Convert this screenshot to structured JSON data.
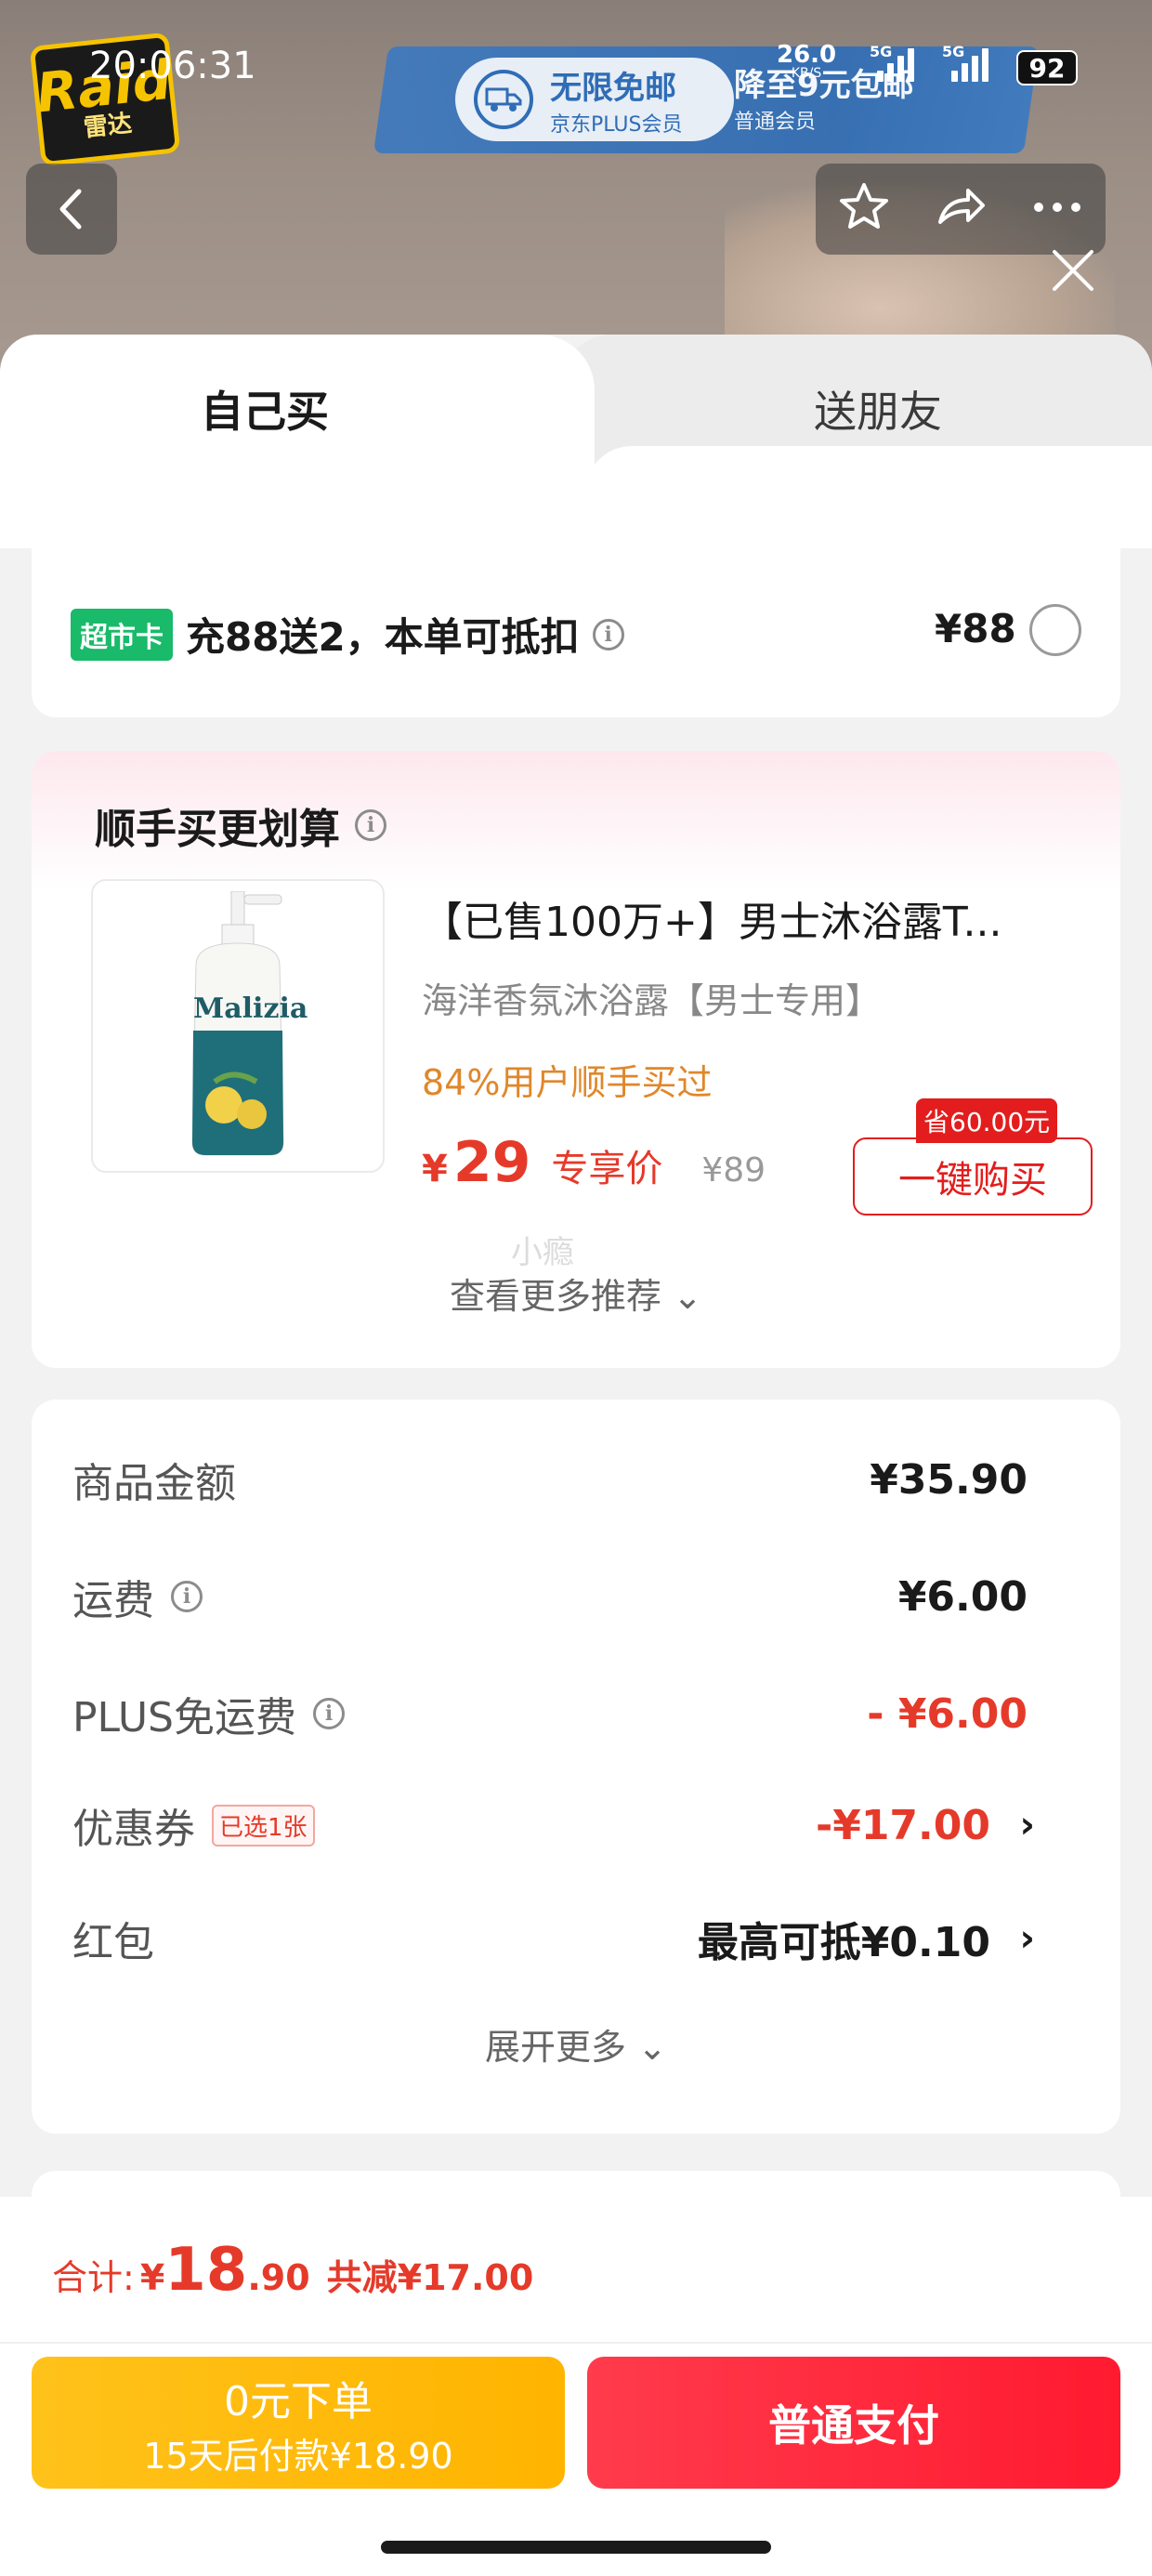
{
  "status_bar": {
    "time": "20:06:31",
    "speed_value": "26.0",
    "speed_unit": "KB/S",
    "network_1": "5G",
    "network_2": "5G",
    "battery": "92"
  },
  "hero": {
    "logo_text": "Raid",
    "logo_cn": "雷达",
    "badge_main": "无限免邮",
    "badge_sub": "京东PLUS会员",
    "promo_main": "降至9元包邮",
    "promo_sub": "普通会员"
  },
  "tabs": {
    "self_buy": "自己买",
    "gift_friend": "送朋友"
  },
  "supermarket_card": {
    "tag": "超市卡",
    "text": "充88送2，本单可抵扣",
    "price": "¥88"
  },
  "recommend": {
    "title": "顺手买更划算",
    "product": {
      "image_brand": "Malizia",
      "title": "【已售100万+】男士沐浴露T...",
      "subtitle": "海洋香氛沐浴露【男士专用】",
      "rate": "84%用户顺手买过",
      "price_currency": "¥",
      "price": "29",
      "price_tag": "专享价",
      "original_price": "¥89",
      "save_tag": "省60.00元",
      "buy_label": "一键购买"
    },
    "watermark": "小瘾",
    "more_label": "查看更多推荐 ⌄"
  },
  "amounts": {
    "rows": [
      {
        "label": "商品金额",
        "value": "¥35.90"
      },
      {
        "label": "运费",
        "value": "¥6.00"
      },
      {
        "label": "PLUS免运费",
        "value": "- ¥6.00"
      },
      {
        "label": "优惠券",
        "badge": "已选1张",
        "value": "-¥17.00"
      },
      {
        "label": "红包",
        "value": "最高可抵¥0.10"
      }
    ],
    "expand_label": "展开更多 ⌄"
  },
  "footer": {
    "total_label": "合计:",
    "total_currency": "¥",
    "total_int": "18",
    "total_dec": ".90",
    "total_save": "共减¥17.00",
    "zero_main": "0元下单",
    "zero_sub": "15天后付款¥18.90",
    "pay_label": "普通支付"
  },
  "colors": {
    "accent_red": "#e53a2a",
    "supermarket_green": "#19ba6a",
    "zero_btn_yellow": "#ffb400",
    "pay_btn_red": "#ff1a30",
    "rate_orange": "#e0872a"
  },
  "icons": [
    "back-icon",
    "star-icon",
    "share-icon",
    "more-icon",
    "close-icon",
    "info-icon",
    "chevron-right-icon",
    "truck-icon"
  ]
}
